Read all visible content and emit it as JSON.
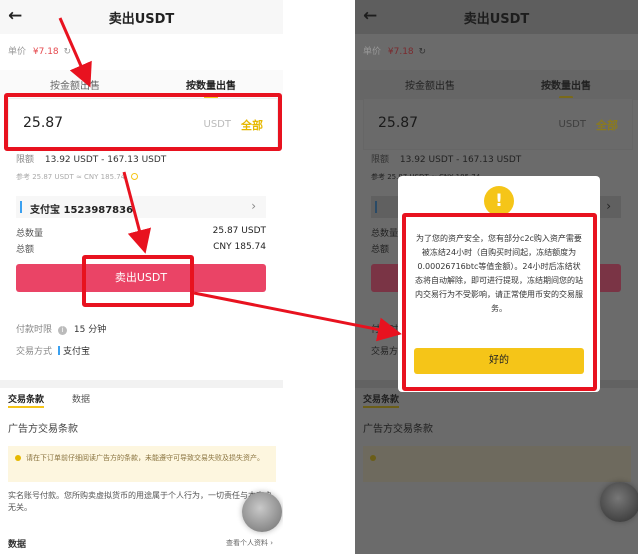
{
  "left": {
    "back_glyph": "←",
    "title": "卖出USDT",
    "price_label": "单价",
    "price_value": "¥7.18",
    "refresh_glyph": "↻",
    "tab_by_amount": "按金额出售",
    "tab_by_quantity": "按数量出售",
    "amount_value": "25.87",
    "amount_unit": "USDT",
    "amount_all": "全部",
    "limit_label": "限额",
    "limit_value": "13.92 USDT - 167.13 USDT",
    "reference_text": "参考 25.87 USDT ≈ CNY 185.74",
    "pay_method": "支付宝  1523987836",
    "pay_chevron": "›",
    "total_qty_label": "总数量",
    "total_qty_value": "25.87 USDT",
    "total_amt_label": "总额",
    "total_amt_value": "CNY 185.74",
    "sell_button": "卖出USDT",
    "pay_time_label": "付款时限",
    "pay_time_info": "i",
    "pay_time_value": "15 分钟",
    "trade_method_label": "交易方式",
    "trade_method_value": "支付宝",
    "tab_terms": "交易条款",
    "tab_data": "数据",
    "terms_title": "广告方交易条款",
    "notice_text": "请在下订单前仔细阅读广告方的条款，未能遵守可导致交易失败及损失资产。",
    "terms_body": "实名账号付款。您所购卖虚拟货币的用途属于个人行为，一切责任与本商户无关。",
    "bottom_left": "数据",
    "bottom_right": "查看个人资料 ›"
  },
  "right": {
    "back_glyph": "←",
    "title": "卖出USDT",
    "price_label": "单价",
    "price_value": "¥7.18",
    "refresh_glyph": "↻",
    "tab_by_amount": "按金额出售",
    "tab_by_quantity": "按数量出售",
    "amount_value": "25.87",
    "amount_unit": "USDT",
    "amount_all": "全部",
    "limit_label": "限额",
    "limit_value": "13.92 USDT - 167.13 USDT",
    "reference_text": "参考 25.87 USDT ≈ CNY 185.74",
    "pay_chevron": "›",
    "total_qty_label": "总数量",
    "total_amt_label": "总额",
    "pay_time_label": "付款时限",
    "trade_method_label": "交易方式",
    "tab_terms": "交易条款",
    "terms_title": "广告方交易条款",
    "modal_icon": "!",
    "modal_text": "为了您的资产安全，您有部分c2c购入资产需要被冻结24小时（自购买时间起，冻结额度为0.00026716btc等值金额）。24小时后冻结状态将自动解除，即可进行提现，冻结期间您的站内交易行为不受影响，请正常使用币安的交易服务。",
    "modal_button": "好的"
  },
  "colors": {
    "sell_red": "#ea4466",
    "accent_yellow": "#f5c518",
    "annotation_red": "#e8121f"
  }
}
